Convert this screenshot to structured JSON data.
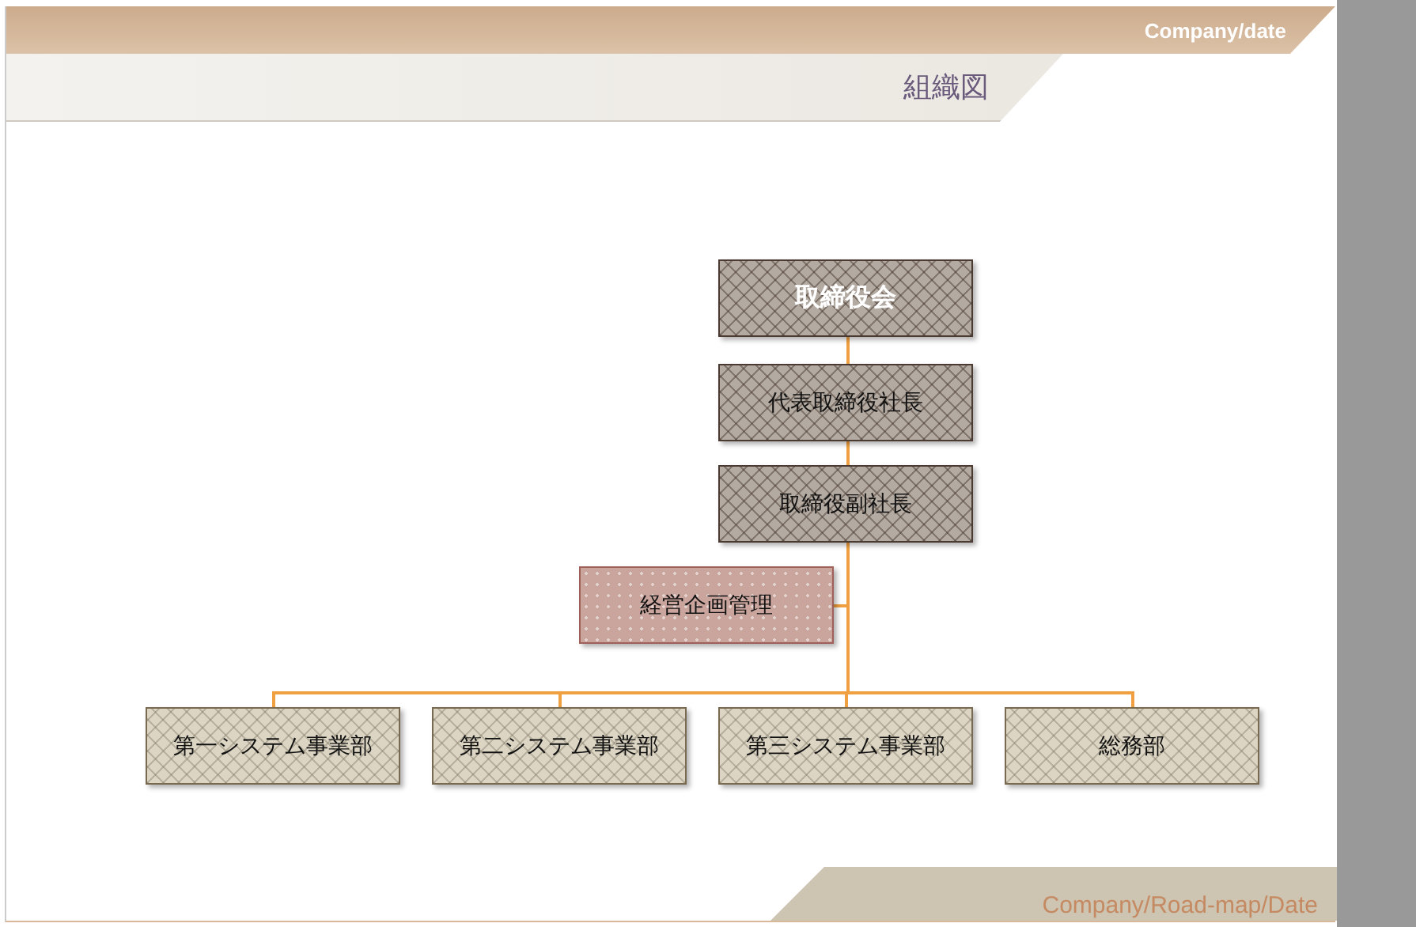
{
  "header": {
    "company_date": "Company/date",
    "title": "組織図"
  },
  "org_chart": {
    "chain": [
      {
        "label": "取締役会",
        "kind": "board"
      },
      {
        "label": "代表取締役社長",
        "kind": "exec"
      },
      {
        "label": "取締役副社長",
        "kind": "exec"
      }
    ],
    "staff": {
      "label": "経営企画管理",
      "kind": "staff"
    },
    "departments": [
      {
        "label": "第一システム事業部",
        "kind": "dept"
      },
      {
        "label": "第二システム事業部",
        "kind": "dept"
      },
      {
        "label": "第三システム事業部",
        "kind": "dept"
      },
      {
        "label": "総務部",
        "kind": "dept"
      }
    ]
  },
  "footer": {
    "text": "Company/Road-map/Date"
  }
}
